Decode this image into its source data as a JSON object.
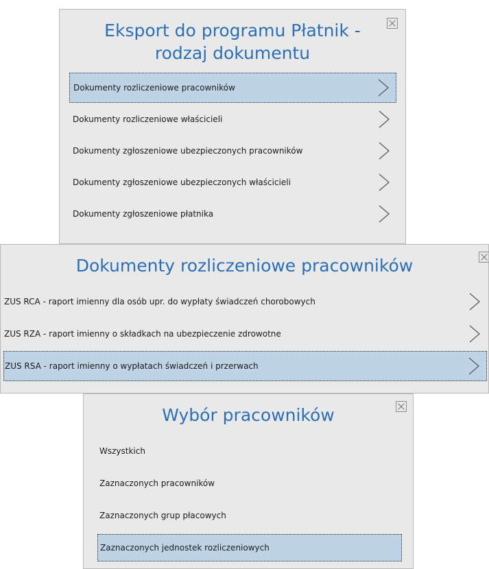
{
  "panel1": {
    "title_line1": "Eksport do programu Płatnik -",
    "title_line2": "rodzaj dokumentu",
    "items": [
      {
        "label": "Dokumenty rozliczeniowe pracowników",
        "selected": true
      },
      {
        "label": "Dokumenty rozliczeniowe właścicieli",
        "selected": false
      },
      {
        "label": "Dokumenty zgłoszeniowe ubezpieczonych pracowników",
        "selected": false
      },
      {
        "label": "Dokumenty zgłoszeniowe ubezpieczonych właścicieli",
        "selected": false
      },
      {
        "label": "Dokumenty zgłoszeniowe płatnika",
        "selected": false
      }
    ]
  },
  "panel2": {
    "title": "Dokumenty rozliczeniowe pracowników",
    "items": [
      {
        "label": "ZUS RCA - raport imienny dla osób upr. do wypłaty świadczeń chorobowych",
        "selected": false
      },
      {
        "label": "ZUS RZA - raport imienny o składkach na ubezpieczenie zdrowotne",
        "selected": false
      },
      {
        "label": "ZUS RSA - raport imienny o wypłatach świadczeń i przerwach",
        "selected": true
      }
    ]
  },
  "panel3": {
    "title": "Wybór pracowników",
    "items": [
      {
        "label": "Wszystkich",
        "selected": false
      },
      {
        "label": "Zaznaczonych pracowników",
        "selected": false
      },
      {
        "label": "Zaznaczonych grup płacowych",
        "selected": false
      },
      {
        "label": "Zaznaczonych jednostek rozliczeniowych",
        "selected": true
      }
    ]
  },
  "colors": {
    "title": "#2d6fb4",
    "panel_bg": "#e9e9e9",
    "selected_bg": "#bfd3e6"
  },
  "icons": {
    "close": "close-icon",
    "chevron": "chevron-right-icon"
  }
}
